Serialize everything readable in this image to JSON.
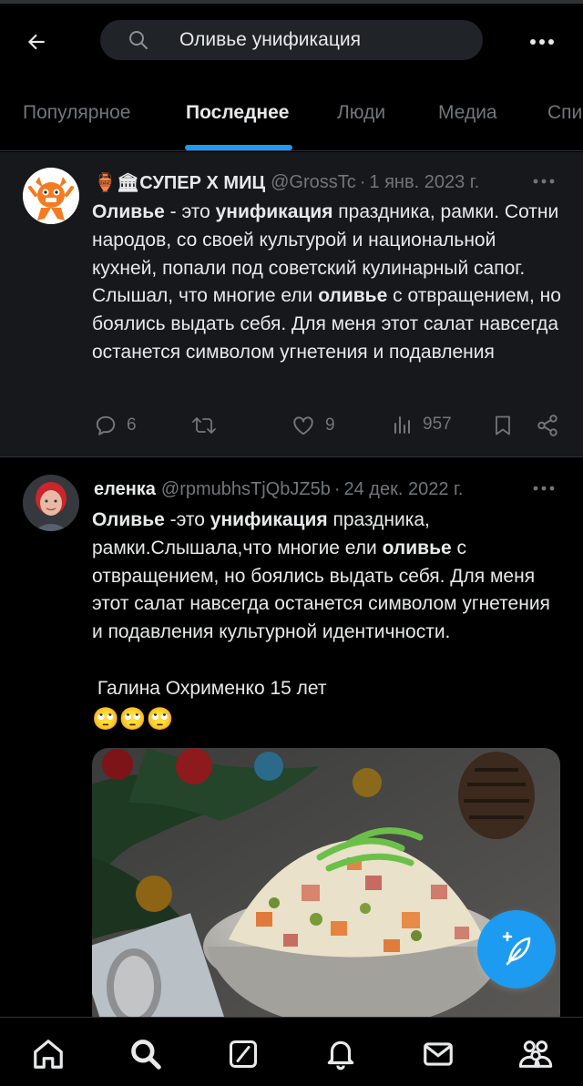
{
  "search": {
    "query": "Оливье унификация"
  },
  "tabs": [
    {
      "label": "Популярное"
    },
    {
      "label": "Последнее"
    },
    {
      "label": "Люди"
    },
    {
      "label": "Медиа"
    },
    {
      "label": "Спи"
    }
  ],
  "tweets": [
    {
      "author_name": "🏺🏛СУПЕР Х МИЦ",
      "author_handle": "@GrossTc",
      "separator": "·",
      "date": "1 янв. 2023 г.",
      "text_parts": {
        "p1": "Оливье",
        "p2": " - это ",
        "p3": "унификация",
        "p4": " праздника, рамки. Сотни народов, со своей культурой и национальной кухней, попали под советский кулинарный сапог. Слышал, что многие ели ",
        "p5": "оливье",
        "p6": " с отвращением, но боялись выдать себя. Для меня этот салат навсегда останется символом угнетения и подавления"
      },
      "replies": "6",
      "reposts": "",
      "likes": "9",
      "views": "957"
    },
    {
      "author_name": "еленка",
      "author_handle": "@rpmubhsTjQbJZ5b",
      "separator": "·",
      "date": "24 дек. 2022 г.",
      "text_parts": {
        "p1": "Оливье",
        "p2": " -это ",
        "p3": "унификация",
        "p4": " праздника, рамки.Слышала,что многие ели ",
        "p5": "оливье",
        "p6": " с отвращением, но боялись выдать себя. Для меня этот салат навсегда останется символом угнетения и подавления культурной идентичности."
      },
      "signature": " Галина Охрименко 15 лет",
      "emojis": "🙄🙄🙄"
    }
  ],
  "more_dots": "•••",
  "colors": {
    "accent": "#1d9bf0",
    "muted": "#71767b",
    "text": "#e7e9ea",
    "background": "#000000",
    "highlight_row": "#16181c"
  },
  "icons": [
    "back-arrow-icon",
    "search-icon",
    "more-icon",
    "reply-icon",
    "repost-icon",
    "like-icon",
    "views-icon",
    "bookmark-icon",
    "share-icon",
    "compose-icon",
    "home-icon",
    "grok-icon",
    "notifications-icon",
    "messages-icon",
    "communities-icon"
  ]
}
